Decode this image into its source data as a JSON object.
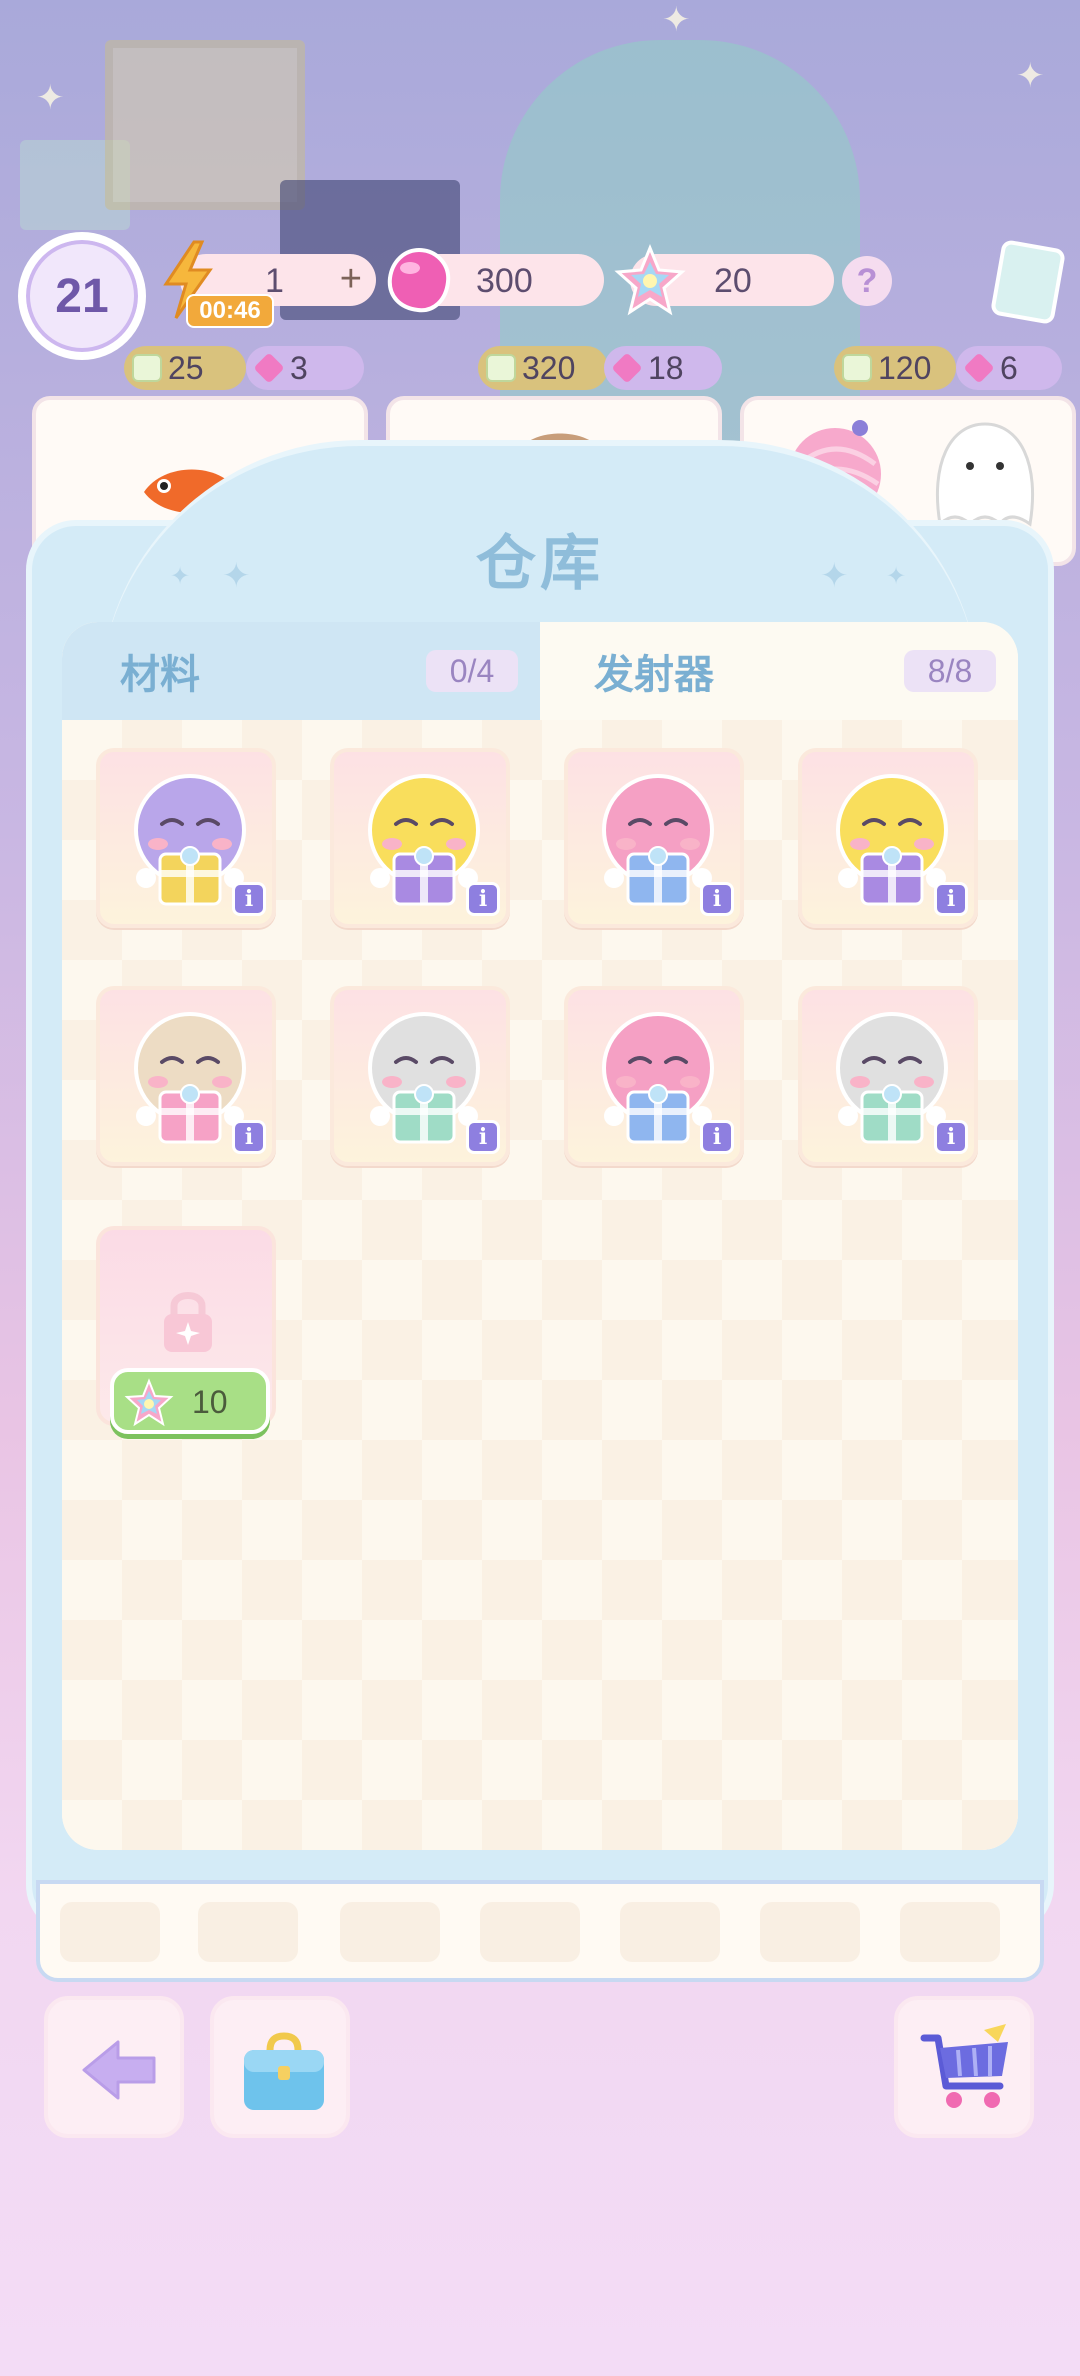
{
  "hud": {
    "level": "21",
    "energy": "1",
    "energy_plus": "+",
    "energy_timer": "00:46",
    "gems": "300",
    "stars": "20",
    "help": "?"
  },
  "tasks": [
    {
      "exp": "25",
      "gems": "3"
    },
    {
      "exp": "320",
      "gems": "18"
    },
    {
      "exp": "120",
      "gems": "6"
    }
  ],
  "warehouse": {
    "title": "仓库",
    "tabs": [
      {
        "label": "材料",
        "count": "0/4",
        "selected": false
      },
      {
        "label": "发射器",
        "count": "8/8",
        "selected": true
      }
    ],
    "items": [
      {
        "icon": "purple-octopus-gift-icon",
        "body": "#b9a6ea",
        "gift": "#f3d45c"
      },
      {
        "icon": "yellow-chick-gift-icon",
        "body": "#f9de5c",
        "gift": "#a98ae2"
      },
      {
        "icon": "pink-octopus-gift-icon",
        "body": "#f5a0c4",
        "gift": "#8fb6ef"
      },
      {
        "icon": "yellow-chick-gift-icon",
        "body": "#f9de5c",
        "gift": "#a98ae2"
      },
      {
        "icon": "pug-gift-icon",
        "body": "#eddcc4",
        "gift": "#f6a2c6"
      },
      {
        "icon": "grey-ghost-gift-icon",
        "body": "#e0e0e0",
        "gift": "#9fdcc6"
      },
      {
        "icon": "pink-octopus-gift-icon",
        "body": "#f5a0c4",
        "gift": "#8fb6ef"
      },
      {
        "icon": "grey-ghost-gift-icon",
        "body": "#e0e0e0",
        "gift": "#9fdcc6"
      }
    ],
    "info_label": "i",
    "unlock_cost": "10"
  },
  "colors": {
    "panel": "#d4ebf7",
    "title": "#8fbdda",
    "info_badge": "#8e7fe0",
    "unlock_button": "#a8df86"
  }
}
